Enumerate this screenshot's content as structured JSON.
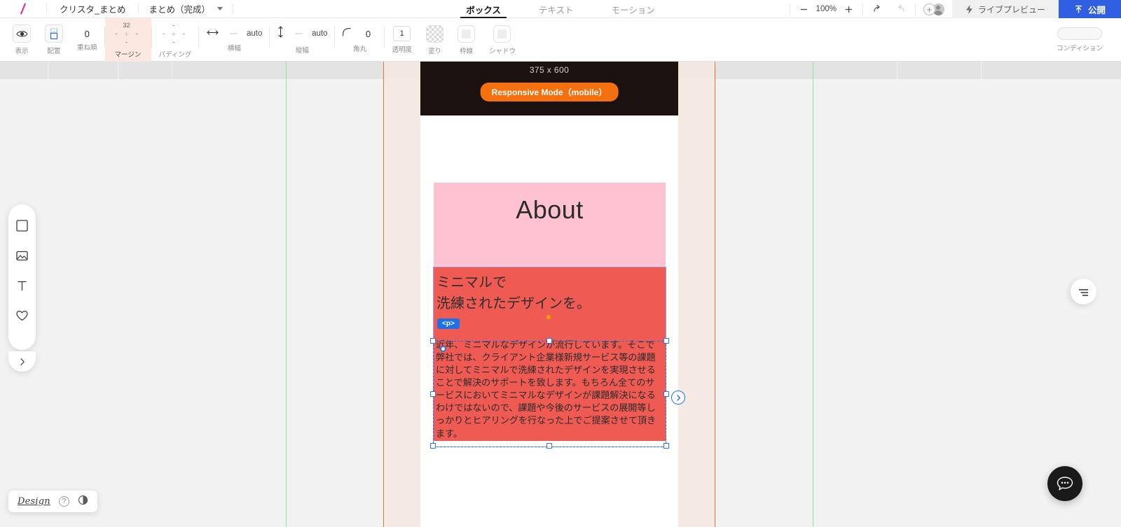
{
  "topbar": {
    "logo_icon": "slash-logo",
    "project_name": "クリスタ_まとめ",
    "page_name": "まとめ（完成）",
    "page_caret_icon": "chevron-down-icon",
    "tabs": [
      {
        "label": "ボックス",
        "active": true
      },
      {
        "label": "テキスト",
        "active": false
      },
      {
        "label": "モーション",
        "active": false
      }
    ],
    "zoom": {
      "minus_icon": "minus-icon",
      "value": "100%",
      "plus_icon": "plus-icon"
    },
    "undo_icon": "undo-arrow-icon",
    "redo_icon": "redo-arrow-icon",
    "add_member_icon": "plus-circle-icon",
    "avatar_icon": "user-avatar-icon",
    "live_preview": {
      "icon": "lightning-icon",
      "label": "ライブプレビュー"
    },
    "publish": {
      "icon": "publish-upload-icon",
      "label": "公開"
    }
  },
  "proptoolbar": {
    "visibility": {
      "icon": "eye-icon",
      "label": "表示"
    },
    "layout": {
      "icon": "box-placement-icon",
      "label": "配置"
    },
    "zorder": {
      "label": "重ね順",
      "value": "0"
    },
    "margin": {
      "label": "マージン",
      "top": "32",
      "right": "-",
      "bottom": "-",
      "left": "-",
      "center_icon": "link-plus-icon",
      "highlighted": true
    },
    "padding": {
      "label": "パディング",
      "top": "-",
      "right": "-",
      "bottom": "-",
      "left": "-",
      "center_icon": "link-plus-icon"
    },
    "width": {
      "label": "横幅",
      "icon": "arrows-horizontal-icon",
      "value": "----",
      "mode": "auto"
    },
    "height": {
      "label": "縦幅",
      "icon": "arrows-vertical-icon",
      "value": "----",
      "mode": "auto"
    },
    "radius": {
      "label": "角丸",
      "icon": "corner-radius-icon",
      "value": "0"
    },
    "opacity": {
      "label": "透明度",
      "value": "1"
    },
    "fill": {
      "label": "塗り",
      "icon": "checker-swatch-icon"
    },
    "border": {
      "label": "枠線",
      "icon": "border-swatch-icon"
    },
    "shadow": {
      "label": "シャドウ",
      "icon": "shadow-swatch-icon"
    },
    "condition": {
      "label": "コンディション",
      "icon": "toggle-pill-icon"
    }
  },
  "canvas": {
    "device": {
      "dimensions": "375 x 600",
      "responsive_badge": "Responsive Mode（mobile）",
      "badge_color": "#f4700f",
      "header_bg": "#1b120f"
    },
    "about_section": {
      "heading": "About",
      "bg_color": "#ffc2d0"
    },
    "red_section": {
      "bg_color": "#ef5a53",
      "headline_line1": "ミニマルで",
      "headline_line2": "洗練されたデザインを。",
      "tag_badge": "<p>",
      "body": "近年、ミニマルなデザインが流行しています。そこで弊社では、クライアント企業様新規サービス等の課題に対してミニマルで洗練されたデザインを実現させることで解決のサポートを致します。もちろん全てのサービスにおいてミニマルなデザインが課題解決になるわけではないので、課題や今後のサービスの展開等しっかりとヒアリングを行なった上でご提案させて頂きます。"
    },
    "next_element_icon": "chevron-right-circle-icon"
  },
  "tool_palette": {
    "items": [
      {
        "icon": "box-tool-icon",
        "name": "box"
      },
      {
        "icon": "image-tool-icon",
        "name": "image"
      },
      {
        "icon": "text-tool-icon",
        "name": "text"
      },
      {
        "icon": "heart-tool-icon",
        "name": "heart"
      }
    ],
    "expand_icon": "chevron-right-icon"
  },
  "footer": {
    "design_label": "Design",
    "help_icon": "question-circle-icon",
    "theme_icon": "contrast-moon-icon"
  },
  "floating": {
    "panel_toggle_icon": "panel-lines-icon",
    "chat_icon": "chat-bubble-icon"
  }
}
